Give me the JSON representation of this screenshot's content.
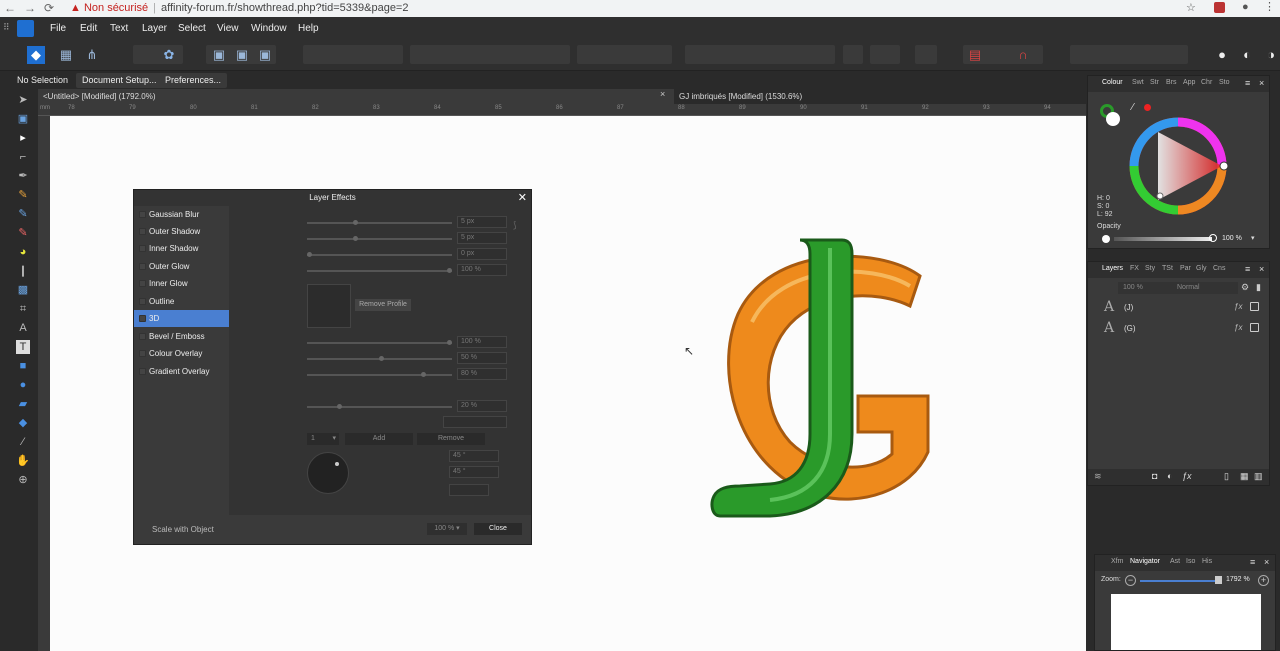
{
  "browser": {
    "back": "←",
    "forward": "→",
    "reload": "⟳",
    "security_warning": "Non sécurisé",
    "url": "affinity-forum.fr/showthread.php?tid=5339&page=2"
  },
  "menu": [
    "File",
    "Edit",
    "Text",
    "Layer",
    "Select",
    "View",
    "Window",
    "Help"
  ],
  "context_bar": {
    "selection": "No Selection",
    "document_setup": "Document Setup...",
    "preferences": "Preferences..."
  },
  "doc_tabs": [
    {
      "label": "<Untitled> [Modified] (1792.0%)"
    },
    {
      "label": "GJ imbriqués [Modified] (1530.6%)"
    }
  ],
  "ruler_numbers": [
    "78",
    "79",
    "80",
    "81",
    "82",
    "83",
    "84",
    "85",
    "86",
    "87",
    "88",
    "89",
    "90",
    "91",
    "92",
    "93",
    "94"
  ],
  "ruler_unit": "mm",
  "layer_effects": {
    "title": "Layer Effects",
    "effects": [
      "Gaussian Blur",
      "Outer Shadow",
      "Inner Shadow",
      "Outer Glow",
      "Inner Glow",
      "Outline",
      "3D",
      "Bevel / Emboss",
      "Colour Overlay",
      "Gradient Overlay"
    ],
    "selected_effect": "3D",
    "fields": {
      "radius": "5 px",
      "depth": "5 px",
      "offset": "0 px",
      "opacity": "100 %",
      "hl_opacity": "100 %",
      "shadow": "50 %",
      "diffuse": "80 %",
      "specular": "20 %",
      "azimuth": "45 °",
      "elevation": "45 °"
    },
    "remove_profile": "Remove Profile",
    "light_index": "1",
    "add": "Add",
    "remove": "Remove",
    "scale_with_object": "Scale with Object",
    "scale_value": "100 %",
    "close": "Close"
  },
  "colour_panel": {
    "tabs": [
      "Colour",
      "Swt",
      "Str",
      "Brs",
      "App",
      "Chr",
      "Sto"
    ],
    "h": "H: 0",
    "s": "S: 0",
    "l": "L: 92",
    "opacity_label": "Opacity",
    "opacity_value": "100 %"
  },
  "layers_panel": {
    "tabs": [
      "Layers",
      "FX",
      "Sty",
      "TSt",
      "Par",
      "Gly",
      "Cns"
    ],
    "opacity": "100 %",
    "blend_mode": "Normal",
    "layers": [
      {
        "name": "(J)",
        "fx": "ƒx"
      },
      {
        "name": "(G)",
        "fx": "ƒx"
      }
    ]
  },
  "navigator_panel": {
    "tabs": [
      "Xfm",
      "Navigator",
      "Ast",
      "Iso",
      "His"
    ],
    "zoom_label": "Zoom:",
    "zoom_value": "1792 %"
  },
  "colors": {
    "accent": "#4a7fd1",
    "logo_orange": "#f08c1e",
    "logo_green": "#2a9a2a"
  }
}
